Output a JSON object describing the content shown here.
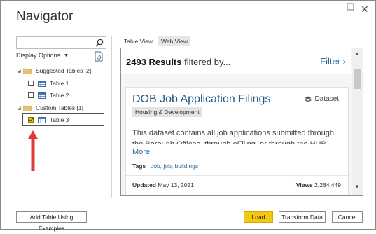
{
  "window": {
    "title": "Navigator"
  },
  "search": {
    "placeholder": ""
  },
  "left": {
    "display_options_label": "Display Options",
    "tree": [
      {
        "label": "Suggested Tables [2]",
        "kind": "folder"
      },
      {
        "label": "Table 1",
        "kind": "table",
        "checked": false
      },
      {
        "label": "Table 2",
        "kind": "table",
        "checked": false
      },
      {
        "label": "Custom Tables [1]",
        "kind": "folder"
      },
      {
        "label": "Table 3",
        "kind": "table",
        "checked": true
      }
    ]
  },
  "tabs": [
    {
      "label": "Table View",
      "active": false
    },
    {
      "label": "Web View",
      "active": true
    }
  ],
  "web": {
    "results_count": "2493 Results",
    "results_suffix": " filtered by...",
    "filter_label": "Filter",
    "filter_chevron": "›",
    "card": {
      "title": "DOB Job Application Filings",
      "type_label": "Dataset",
      "category": "Housing & Development",
      "description": "This dataset contains all job applications submitted through the Borough Offices, through eFiling, or through the HUB.",
      "more_label": "More",
      "tags_label": "Tags",
      "tags": "dob, job, buildings",
      "updated_label": "Updated",
      "updated_value": "May 13, 2021",
      "views_label": "Views",
      "views_value": "2,264,449"
    }
  },
  "buttons": {
    "add_table": "Add Table Using Examples",
    "load": "Load",
    "transform": "Transform Data",
    "cancel": "Cancel"
  },
  "colors": {
    "accent_yellow": "#f2c811",
    "link_blue": "#2d6c9c",
    "annotation_red": "#e03a3a"
  },
  "icons": [
    "search-icon",
    "refresh-icon",
    "folder-icon",
    "table-icon",
    "dataset-icon",
    "close-icon",
    "expand-icon",
    "annotation-arrow-icon"
  ]
}
